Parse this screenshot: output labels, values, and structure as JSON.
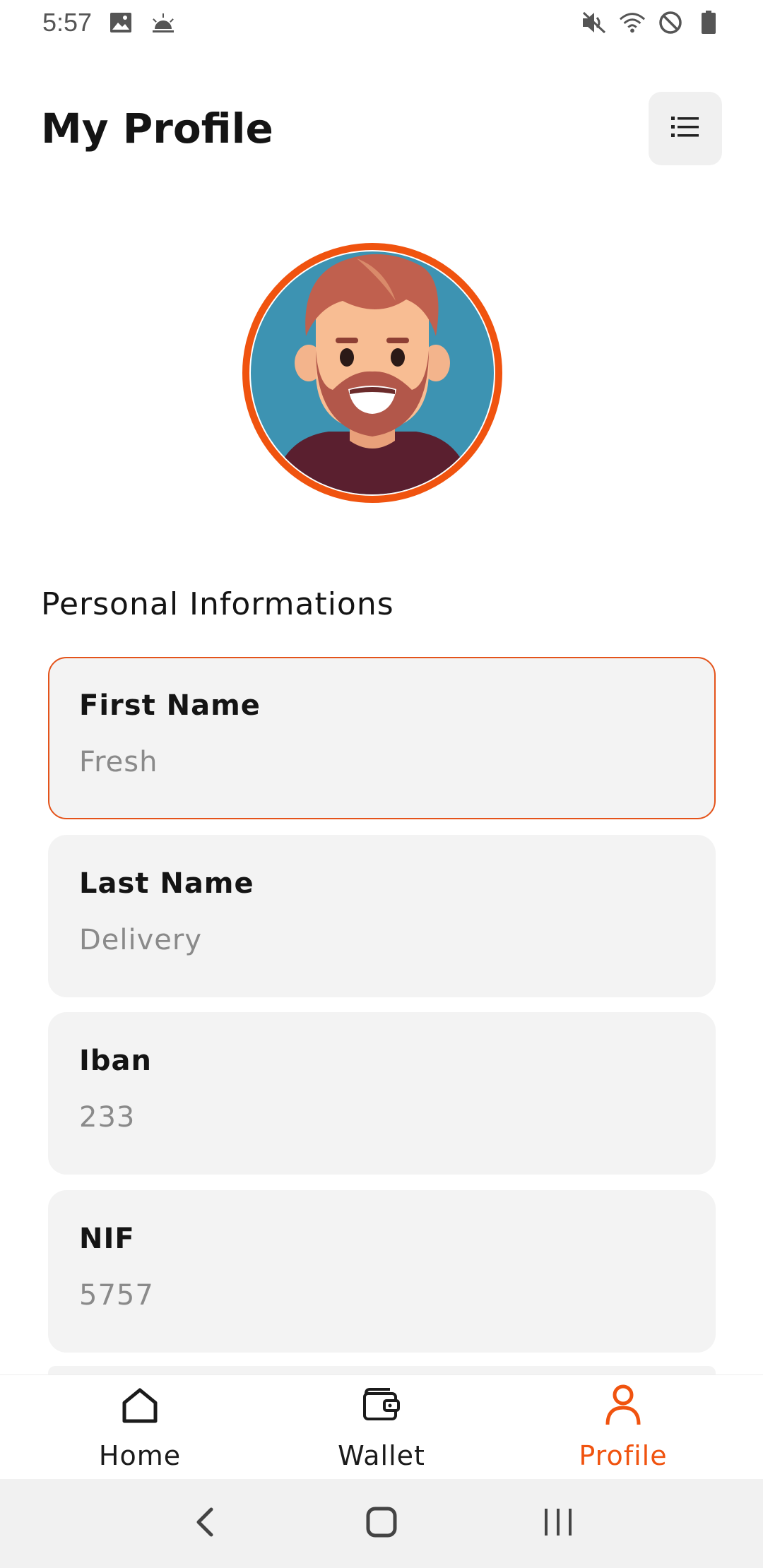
{
  "status_bar": {
    "time": "5:57",
    "left_icons": [
      "image-icon",
      "weather-icon"
    ],
    "right_icons": [
      "mute-icon",
      "wifi-icon",
      "do-not-disturb-icon",
      "battery-icon"
    ]
  },
  "header": {
    "title": "My Profile",
    "menu_icon": "list-menu-icon"
  },
  "section": {
    "title": "Personal Informations"
  },
  "fields": [
    {
      "label": "First Name",
      "value": "Fresh"
    },
    {
      "label": "Last Name",
      "value": "Delivery"
    },
    {
      "label": "Iban",
      "value": "233"
    },
    {
      "label": "NIF",
      "value": "5757"
    }
  ],
  "bottom_nav": {
    "items": [
      {
        "label": "Home",
        "icon": "home-icon"
      },
      {
        "label": "Wallet",
        "icon": "wallet-icon"
      },
      {
        "label": "Profile",
        "icon": "user-icon"
      }
    ],
    "active": "Profile"
  },
  "colors": {
    "accent": "#f0530f",
    "card_bg": "#f3f3f3",
    "muted_text": "#8a8a8a"
  }
}
